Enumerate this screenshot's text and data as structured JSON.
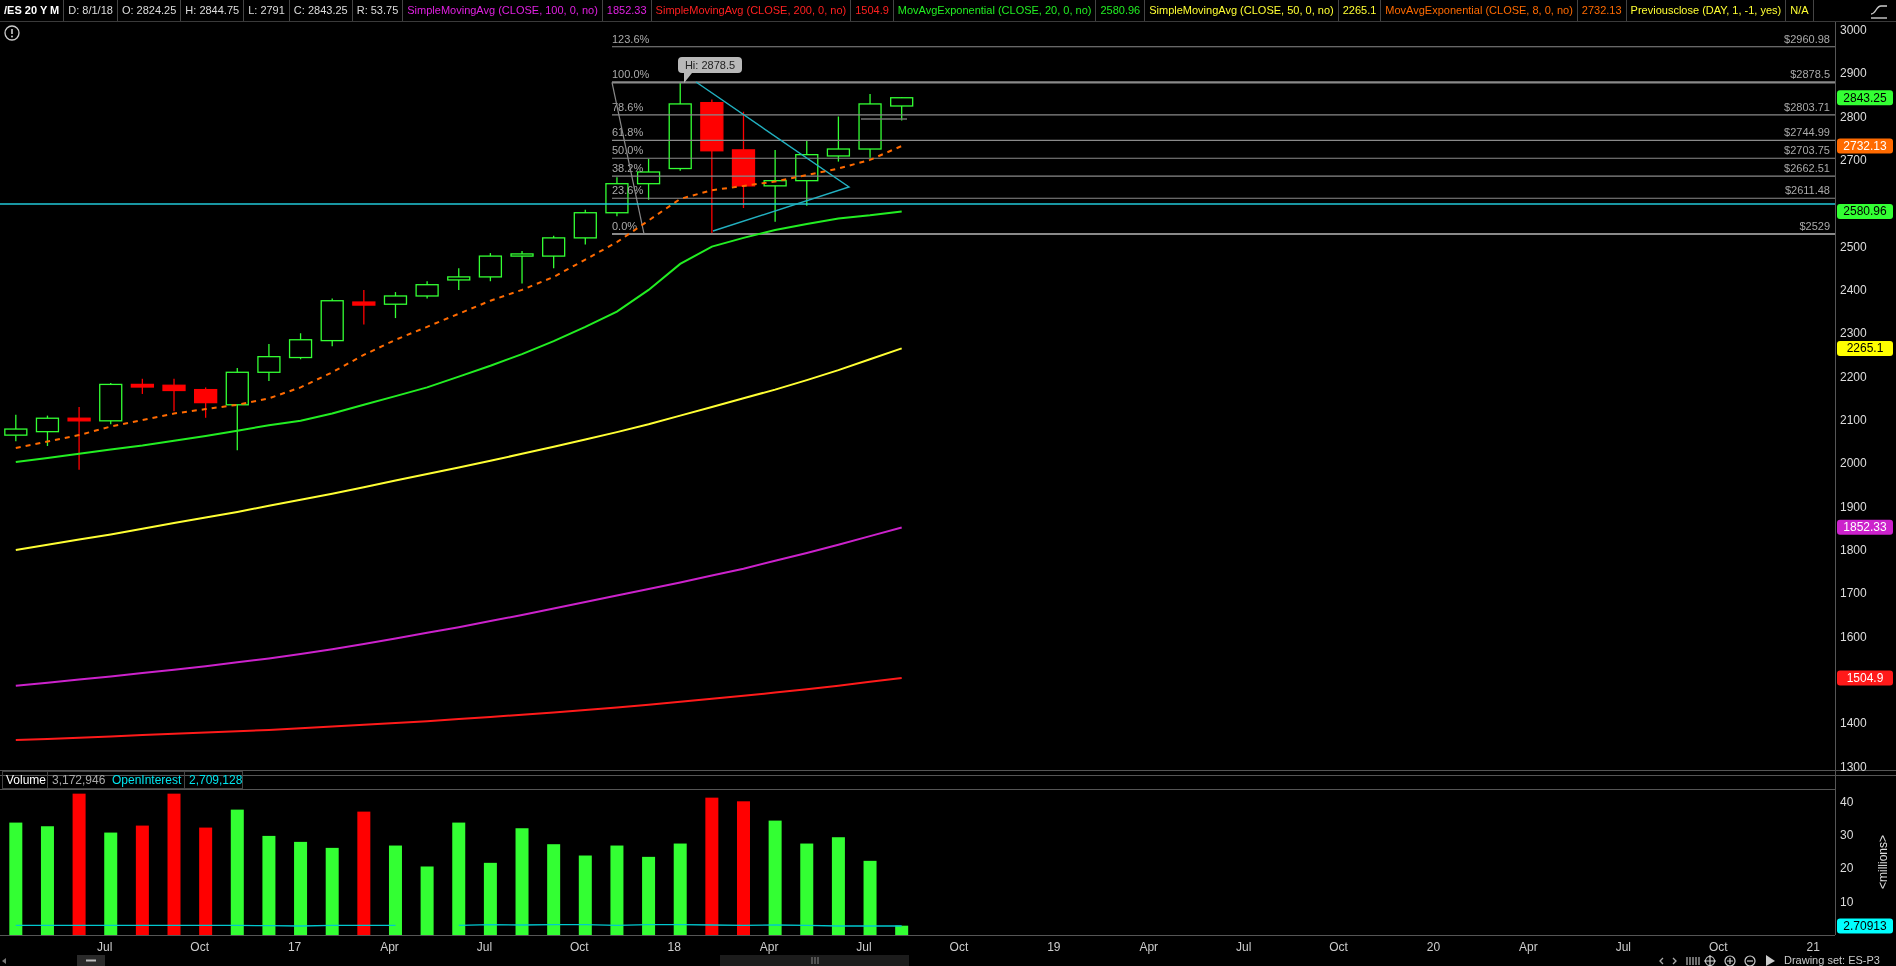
{
  "header": {
    "symbol": "/ES 20 Y M",
    "quote": [
      "D: 8/1/18",
      "O: 2824.25",
      "H: 2844.75",
      "L: 2791",
      "C: 2843.25",
      "R: 53.75"
    ],
    "studies": [
      {
        "name": "SimpleMovingAvg (CLOSE, 100, 0, no)",
        "value": "1852.33",
        "color": "#e020e0"
      },
      {
        "name": "SimpleMovingAvg (CLOSE, 200, 0, no)",
        "value": "1504.9",
        "color": "#ff2020"
      },
      {
        "name": "MovAvgExponential (CLOSE, 20, 0, no)",
        "value": "2580.96",
        "color": "#22ee22"
      },
      {
        "name": "SimpleMovingAvg (CLOSE, 50, 0, no)",
        "value": "2265.1",
        "color": "#ffff33"
      },
      {
        "name": "MovAvgExponential (CLOSE, 8, 0, no)",
        "value": "2732.13",
        "color": "#ff6a00"
      },
      {
        "name": "Previousclose (DAY, 1, -1, yes)",
        "value": "N/A",
        "color": "#ffff33"
      }
    ]
  },
  "price_chart": {
    "chart_data": {
      "type": "line",
      "categories": [
        null,
        null,
        null,
        null,
        null,
        null,
        null,
        null,
        null,
        null,
        null,
        null,
        null,
        null,
        null,
        null,
        null,
        null,
        null,
        null,
        null,
        null,
        null,
        null,
        null,
        null,
        null,
        null,
        null,
        null,
        null,
        null,
        null,
        null,
        null,
        null,
        null,
        null,
        null,
        null,
        null,
        null,
        null,
        null,
        null,
        null,
        null,
        null,
        null,
        null,
        null,
        null,
        null,
        null,
        null,
        null,
        null,
        null
      ],
      "ylim": [
        1281,
        3018
      ],
      "yticks": [
        1300,
        1400,
        1600,
        1700,
        1800,
        1900,
        2000,
        2100,
        2200,
        2300,
        2400,
        2500,
        2700,
        2800,
        2900,
        3000
      ],
      "series": [
        {
          "color": "#cc22cc",
          "line_style": "solid",
          "values": [
            1487,
            1494,
            1501,
            1508,
            1516,
            1524,
            1532,
            1541,
            1550,
            1560,
            1571,
            1583,
            1596,
            1609,
            1622,
            1636,
            1650,
            1665,
            1680,
            1695,
            1710,
            1725,
            1741,
            1757,
            1775,
            1793,
            1812,
            1832,
            1852,
            null,
            null,
            null,
            null,
            null,
            null,
            null,
            null,
            null,
            null,
            null,
            null,
            null,
            null,
            null,
            null,
            null,
            null,
            null,
            null,
            null,
            null,
            null,
            null,
            null,
            null,
            null,
            null,
            null
          ]
        },
        {
          "color": "#ff1a1a",
          "line_style": "solid",
          "values": [
            1362,
            1364,
            1367,
            1370,
            1373,
            1376,
            1379,
            1382,
            1385,
            1389,
            1393,
            1397,
            1401,
            1405,
            1410,
            1415,
            1420,
            1425,
            1431,
            1437,
            1443,
            1450,
            1457,
            1464,
            1471,
            1479,
            1487,
            1496,
            1505,
            null,
            null,
            null,
            null,
            null,
            null,
            null,
            null,
            null,
            null,
            null,
            null,
            null,
            null,
            null,
            null,
            null,
            null,
            null,
            null,
            null,
            null,
            null,
            null,
            null,
            null,
            null,
            null,
            null
          ]
        },
        {
          "color": "#22ee22",
          "line_style": "solid",
          "values": [
            2003,
            2012,
            2022,
            2032,
            2041,
            2052,
            2063,
            2075,
            2088,
            2098,
            2115,
            2135,
            2155,
            2175,
            2200,
            2225,
            2252,
            2282,
            2315,
            2350,
            2400,
            2460,
            2500,
            2520,
            2538,
            2552,
            2565,
            2572,
            2581,
            null,
            null,
            null,
            null,
            null,
            null,
            null,
            null,
            null,
            null,
            null,
            null,
            null,
            null,
            null,
            null,
            null,
            null,
            null,
            null,
            null,
            null,
            null,
            null,
            null,
            null,
            null,
            null,
            null
          ]
        },
        {
          "color": "#ffff33",
          "line_style": "solid",
          "values": [
            1800,
            1812,
            1824,
            1836,
            1849,
            1862,
            1875,
            1888,
            1902,
            1916,
            1930,
            1945,
            1960,
            1975,
            1990,
            2006,
            2022,
            2038,
            2055,
            2072,
            2090,
            2110,
            2130,
            2150,
            2170,
            2192,
            2215,
            2240,
            2265,
            null,
            null,
            null,
            null,
            null,
            null,
            null,
            null,
            null,
            null,
            null,
            null,
            null,
            null,
            null,
            null,
            null,
            null,
            null,
            null,
            null,
            null,
            null,
            null,
            null,
            null,
            null,
            null,
            null
          ]
        },
        {
          "color": "#ff6a00",
          "line_style": "dashed",
          "values": [
            2035,
            2050,
            2065,
            2085,
            2100,
            2115,
            2125,
            2135,
            2150,
            2175,
            2210,
            2250,
            2285,
            2315,
            2345,
            2375,
            2400,
            2430,
            2470,
            2510,
            2560,
            2610,
            2630,
            2640,
            2650,
            2665,
            2680,
            2700,
            2732,
            null,
            null,
            null,
            null,
            null,
            null,
            null,
            null,
            null,
            null,
            null,
            null,
            null,
            null,
            null,
            null,
            null,
            null,
            null,
            null,
            null,
            null,
            null,
            null,
            null,
            null,
            null,
            null,
            null
          ]
        }
      ]
    },
    "fibonacci": [
      {
        "percent": "123.6%",
        "price": "$2960.98"
      },
      {
        "percent": "100.0%",
        "price": "$2878.5"
      },
      {
        "percent": "78.6%",
        "price": "$2803.71"
      },
      {
        "percent": "61.8%",
        "price": "$2744.99"
      },
      {
        "percent": "50.0%",
        "price": "$2703.75"
      },
      {
        "percent": "38.2%",
        "price": "$2662.51"
      },
      {
        "percent": "23.6%",
        "price": "$2611.48"
      },
      {
        "percent": "0.0%",
        "price": "$2529"
      }
    ],
    "high_label": "Hi: 2878.5",
    "price_badges": [
      {
        "text": "2843.25",
        "color": "#33ff33"
      },
      {
        "text": "2732.13",
        "color": "#ff6a00"
      },
      {
        "text": "2580.96",
        "color": "#33ff33"
      },
      {
        "text": "2265.1",
        "color": "#ffff00"
      },
      {
        "text": "1852.33",
        "color": "#cc22cc"
      },
      {
        "text": "1504.9",
        "color": "#ff1a1a"
      }
    ]
  },
  "volume_pane": {
    "legend": [
      {
        "label": "Volume",
        "value": "3,172,946"
      },
      {
        "label": "OpenInterest",
        "value": "2,709,128"
      }
    ],
    "chart_data": {
      "type": "bar",
      "ylabel": "<millions>",
      "ylim": [
        0,
        43.6
      ],
      "yticks": [
        10,
        20,
        30,
        40
      ],
      "categories": [
        null,
        null,
        null,
        "Jul",
        null,
        null,
        "Oct",
        null,
        null,
        "17",
        null,
        null,
        "Apr",
        null,
        null,
        "Jul",
        null,
        null,
        "Oct",
        null,
        null,
        "18",
        null,
        null,
        "Apr",
        null,
        null,
        "Jul",
        null,
        null,
        "Oct",
        null,
        null,
        "19",
        null,
        null,
        "Apr",
        null,
        null,
        "Jul",
        null,
        null,
        "Oct",
        null,
        null,
        "20",
        null,
        null,
        "Apr",
        null,
        null,
        "Jul",
        null,
        null,
        "Oct",
        null,
        null,
        "21"
      ],
      "series": [
        {
          "color": "#33ff33",
          "values": [
            33.8,
            32.7,
            null,
            30.8,
            null,
            null,
            null,
            37.7,
            29.8,
            28.0,
            26.2,
            null,
            26.9,
            20.6,
            33.8,
            21.7,
            32.1,
            27.3,
            23.9,
            26.9,
            23.5,
            27.5,
            null,
            null,
            34.4,
            27.5,
            29.4,
            22.3,
            2.8,
            null,
            null,
            null,
            null,
            null,
            null,
            null,
            null,
            null,
            null,
            null,
            null,
            null,
            null,
            null,
            null,
            null,
            null,
            null,
            null,
            null,
            null,
            null,
            null,
            null,
            null,
            null,
            null,
            null
          ]
        },
        {
          "color": "#ff0000",
          "values": [
            null,
            null,
            42.5,
            null,
            32.9,
            42.5,
            32.3,
            null,
            null,
            null,
            null,
            37.1,
            null,
            null,
            null,
            null,
            null,
            null,
            null,
            null,
            null,
            null,
            41.3,
            40.2,
            null,
            null,
            null,
            null,
            null,
            null,
            null,
            null,
            null,
            null,
            null,
            null,
            null,
            null,
            null,
            null,
            null,
            null,
            null,
            null,
            null,
            null,
            null,
            null,
            null,
            null,
            null,
            null,
            null,
            null,
            null,
            null,
            null,
            null
          ]
        },
        {
          "color": "#00c8d0",
          "type": "line",
          "values": [
            2.9,
            2.9,
            2.9,
            2.9,
            2.9,
            2.9,
            2.9,
            2.9,
            2.8,
            2.7,
            2.9,
            2.9,
            2.9,
            null,
            2.9,
            3.1,
            3.0,
            3.1,
            3.1,
            2.9,
            3.1,
            3.1,
            3.0,
            2.9,
            3.0,
            2.9,
            2.7,
            2.7,
            2.7,
            null,
            null,
            null,
            null,
            null,
            null,
            null,
            null,
            null,
            null,
            null,
            null,
            null,
            null,
            null,
            null,
            null,
            null,
            null,
            null,
            null,
            null,
            null,
            null,
            null,
            null,
            null,
            null,
            null
          ]
        }
      ]
    },
    "badge": {
      "text": "2.70913",
      "color": "#00ffff"
    }
  },
  "footer": {
    "drawing_set": "Drawing set: ES-P3"
  }
}
